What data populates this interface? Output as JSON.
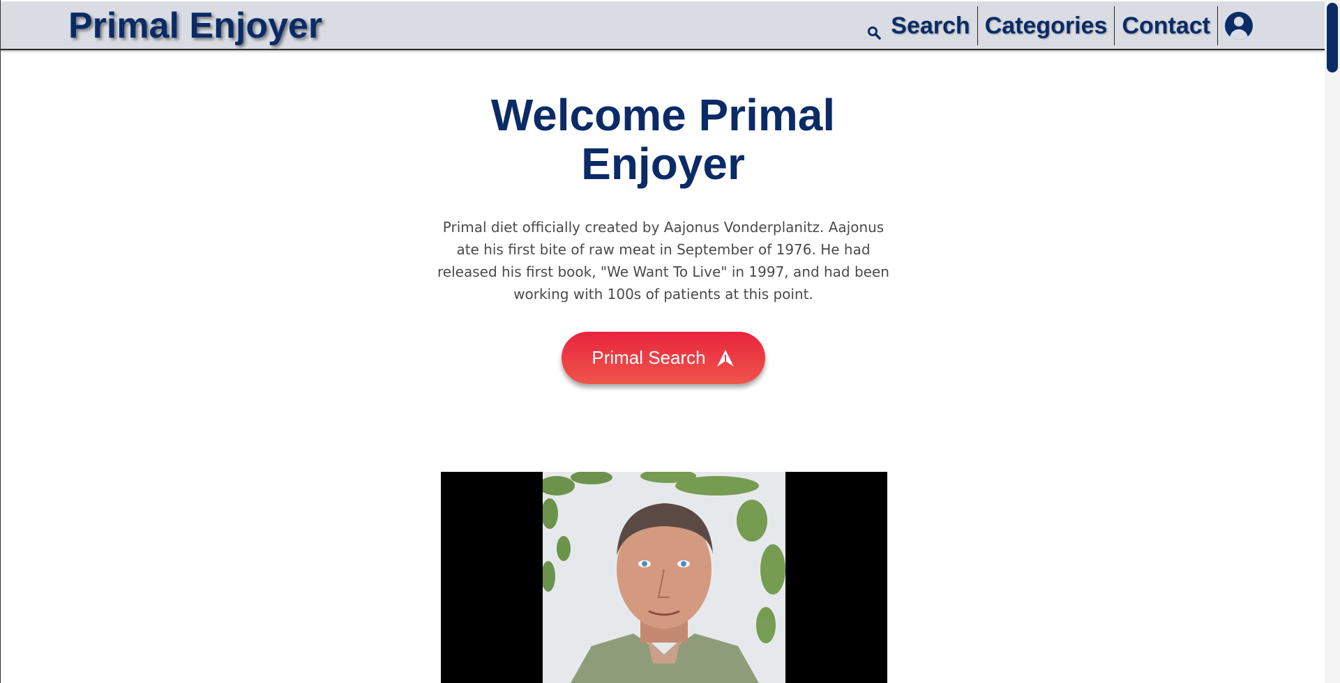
{
  "header": {
    "brand": "Primal Enjoyer",
    "nav": {
      "search_label": "Search",
      "categories_label": "Categories",
      "contact_label": "Contact"
    }
  },
  "hero": {
    "title_line1": "Welcome Primal",
    "title_line2": "Enjoyer",
    "description": "Primal diet officially created by Aajonus Vonderplanitz. Aajonus ate his first bite of raw meat in September of 1976. He had released his first book, \"We Want To Live\" in 1997, and had been working with 100s of patients at this point.",
    "cta_label": "Primal Search"
  },
  "icons": {
    "search": "search-icon",
    "account": "user-circle-icon",
    "cta": "arrow-up-icon"
  },
  "colors": {
    "brand": "#0b2b66",
    "header_bg": "#d9dde3",
    "cta_top": "#e8253f",
    "cta_bottom": "#f05549",
    "body_text": "#4a4a4a"
  }
}
